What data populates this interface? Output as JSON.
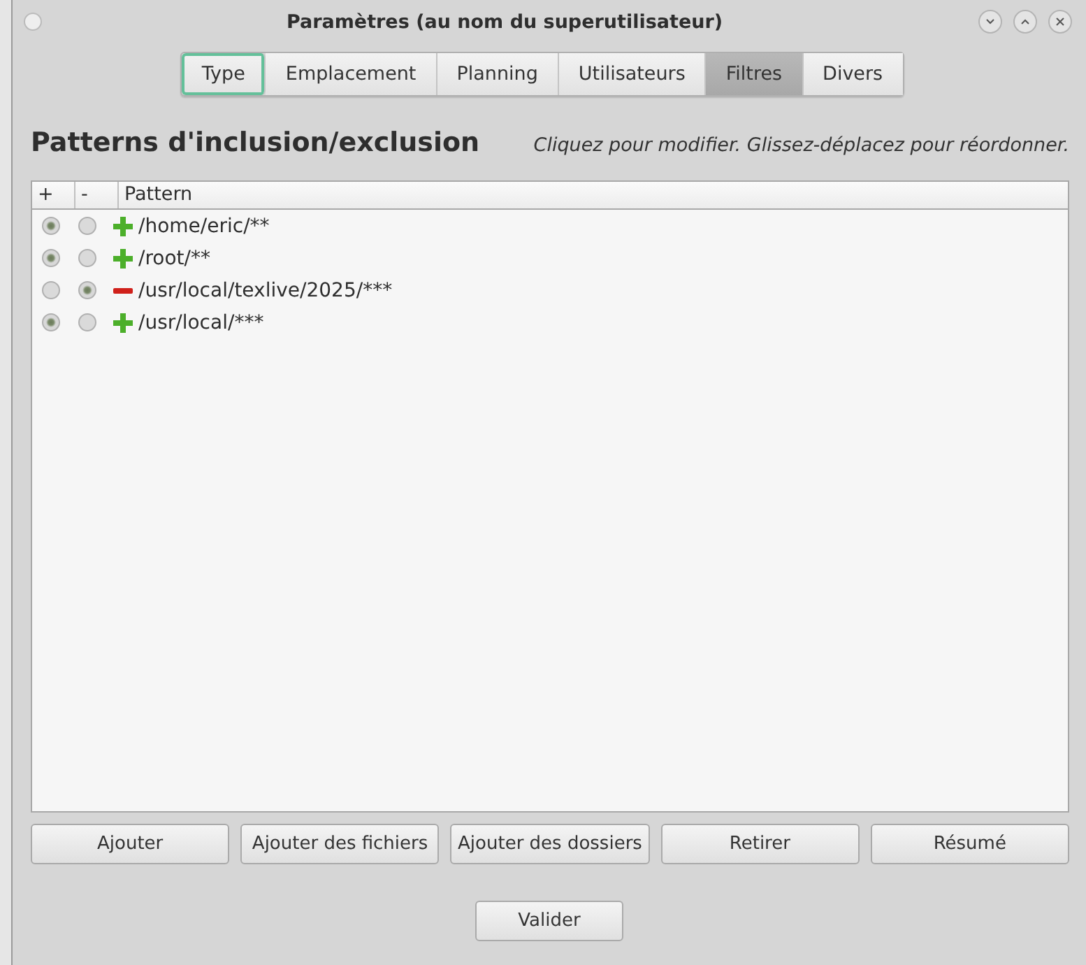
{
  "window": {
    "title": "Paramètres (au nom du superutilisateur)"
  },
  "tabs": [
    {
      "label": "Type",
      "selected": false,
      "focused": true
    },
    {
      "label": "Emplacement",
      "selected": false,
      "focused": false
    },
    {
      "label": "Planning",
      "selected": false,
      "focused": false
    },
    {
      "label": "Utilisateurs",
      "selected": false,
      "focused": false
    },
    {
      "label": "Filtres",
      "selected": true,
      "focused": false
    },
    {
      "label": "Divers",
      "selected": false,
      "focused": false
    }
  ],
  "heading": "Patterns d'inclusion/exclusion",
  "hint": "Cliquez pour modifier. Glissez-déplacez pour réordonner.",
  "table": {
    "columns": [
      "+",
      "-",
      "Pattern"
    ],
    "rows": [
      {
        "include": true,
        "exclude": false,
        "pattern": "/home/eric/**"
      },
      {
        "include": true,
        "exclude": false,
        "pattern": "/root/**"
      },
      {
        "include": false,
        "exclude": true,
        "pattern": "/usr/local/texlive/2025/***"
      },
      {
        "include": true,
        "exclude": false,
        "pattern": "/usr/local/***"
      }
    ]
  },
  "buttons": [
    "Ajouter",
    "Ajouter des fichiers",
    "Ajouter des dossiers",
    "Retirer",
    "Résumé"
  ],
  "ok_button": "Valider"
}
